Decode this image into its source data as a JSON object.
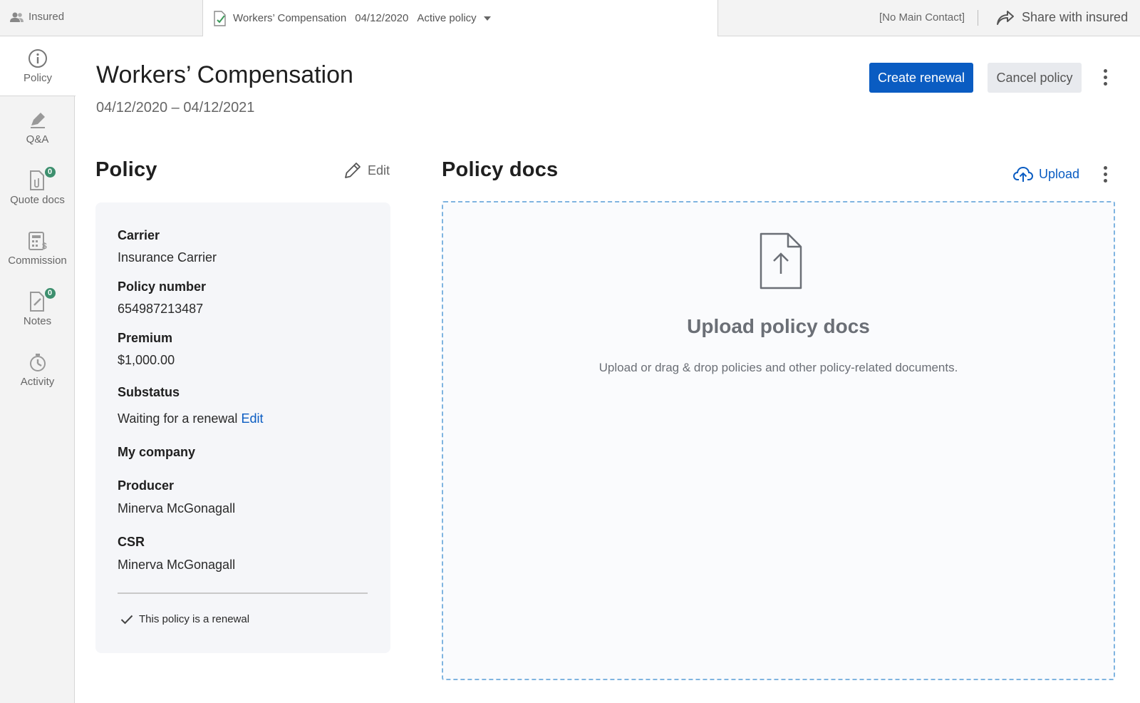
{
  "topbar": {
    "insured_label": "Insured",
    "policy_name": "Workers’ Compensation",
    "policy_date": "04/12/2020",
    "policy_status": "Active policy",
    "main_contact": "[No Main Contact]",
    "share_label": "Share with insured"
  },
  "sidebar": {
    "items": [
      {
        "label": "Policy"
      },
      {
        "label": "Q&A"
      },
      {
        "label": "Quote docs",
        "badge": "0"
      },
      {
        "label": "Commission"
      },
      {
        "label": "Notes",
        "badge": "0"
      },
      {
        "label": "Activity"
      }
    ]
  },
  "header": {
    "title": "Workers’ Compensation",
    "dates": "04/12/2020 – 04/12/2021",
    "create_renewal": "Create renewal",
    "cancel_policy": "Cancel policy"
  },
  "policy": {
    "title": "Policy",
    "edit_label": "Edit",
    "carrier_label": "Carrier",
    "carrier_value": "Insurance Carrier",
    "policy_number_label": "Policy number",
    "policy_number_value": "654987213487",
    "premium_label": "Premium",
    "premium_value": "$1,000.00",
    "substatus_label": "Substatus",
    "substatus_value": "Waiting for a renewal",
    "substatus_edit": "Edit",
    "company_label": "My company",
    "producer_label": "Producer",
    "producer_value": "Minerva McGonagall",
    "csr_label": "CSR",
    "csr_value": "Minerva McGonagall",
    "renewal_note": "This policy is a renewal"
  },
  "docs": {
    "title": "Policy docs",
    "upload_label": "Upload",
    "dropzone_title": "Upload policy docs",
    "dropzone_subtitle": "Upload or drag & drop policies and other policy-related documents."
  },
  "colors": {
    "primary": "#0a5cc2",
    "badge": "#3d8f6e",
    "sidebar_bg": "#f3f3f3",
    "card_bg": "#f5f6f9",
    "dropzone_border": "#7fb4e0"
  }
}
